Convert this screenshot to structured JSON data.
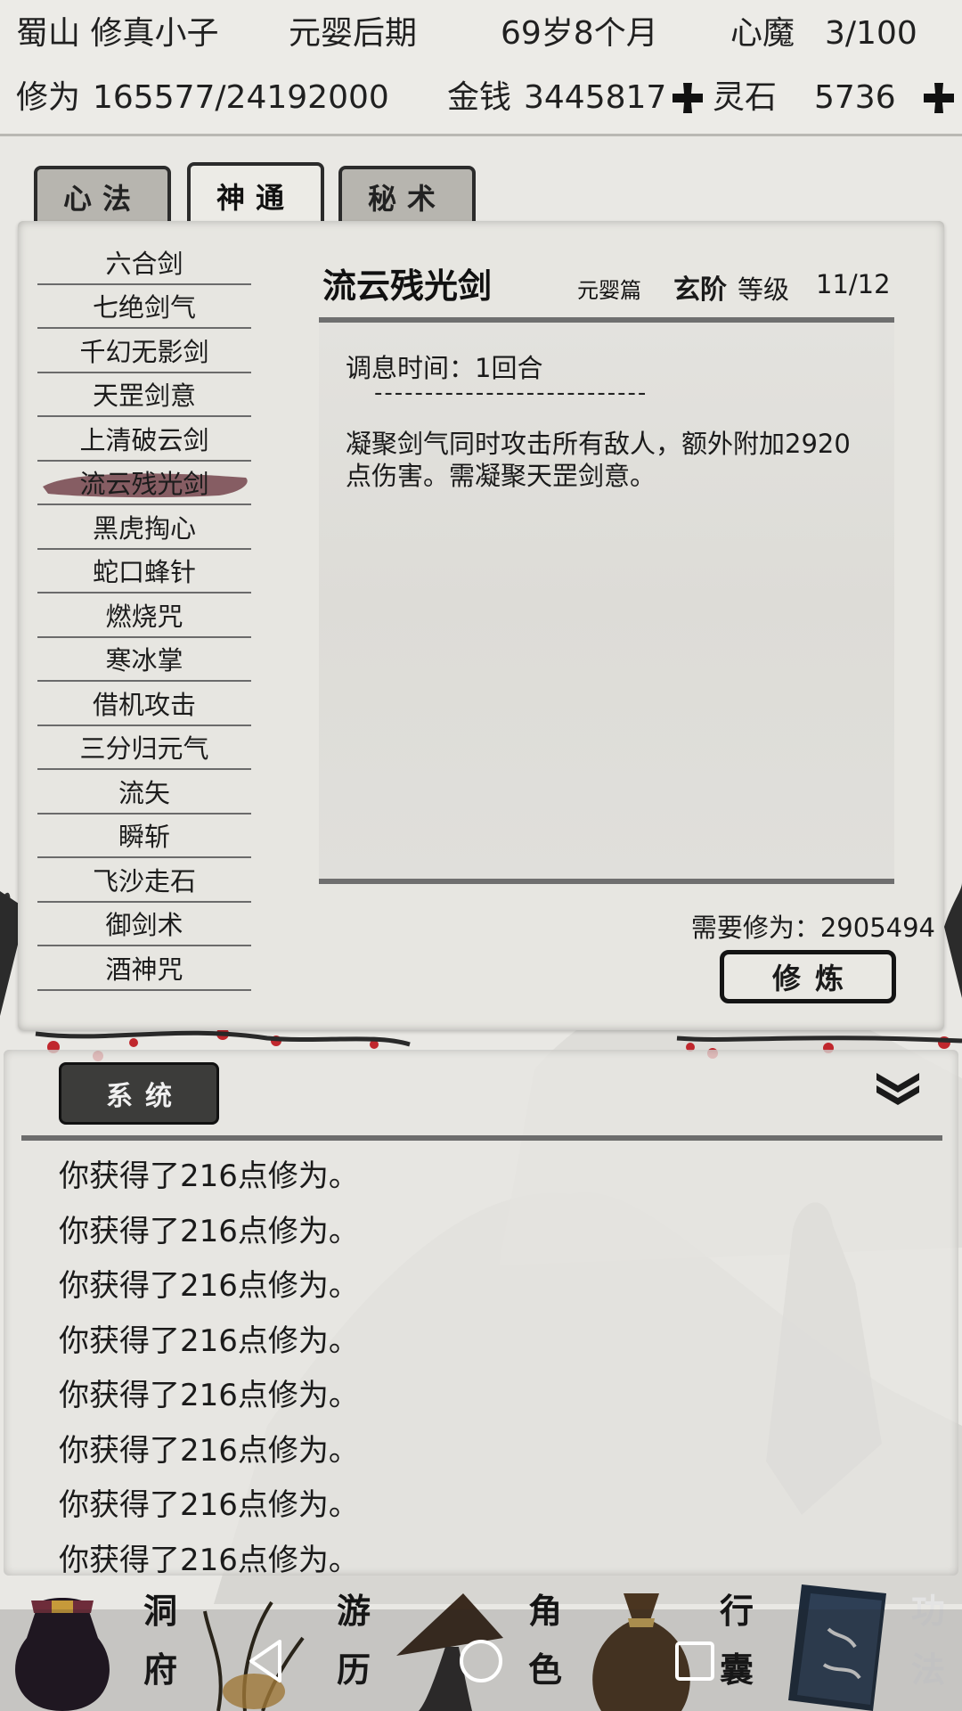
{
  "header": {
    "sect": "蜀山",
    "player_name": "修真小子",
    "realm": "元婴后期",
    "age": "69岁8个月",
    "heart_demon_label": "心魔",
    "heart_demon_value": "3/100",
    "cultivation_label": "修为",
    "cultivation_value": "165577/24192000",
    "money_label": "金钱",
    "money_value": "3445817",
    "spirit_stone_label": "灵石",
    "spirit_stone_value": "5736"
  },
  "tabs": [
    {
      "label": "心法",
      "active": false
    },
    {
      "label": "神通",
      "active": true
    },
    {
      "label": "秘术",
      "active": false
    }
  ],
  "skills": [
    "六合剑",
    "七绝剑气",
    "千幻无影剑",
    "天罡剑意",
    "上清破云剑",
    "流云残光剑",
    "黑虎掏心",
    "蛇口蜂针",
    "燃烧咒",
    "寒冰掌",
    "借机攻击",
    "三分归元气",
    "流矢",
    "瞬斩",
    "飞沙走石",
    "御剑术",
    "酒神咒"
  ],
  "selected_skill_index": 5,
  "detail": {
    "name": "流云残光剑",
    "chapter": "元婴篇",
    "tier": "玄阶",
    "level_label": "等级",
    "level": "11/12",
    "recovery_time": "调息时间：1回合",
    "separator": "---------------------------",
    "description": "凝聚剑气同时攻击所有敌人，额外附加2920点伤害。需凝聚天罡剑意。",
    "required_cultivation": "需要修为：2905494",
    "train_button": "修炼"
  },
  "log": {
    "tab_label": "系统",
    "entries": [
      "你获得了216点修为。",
      "你获得了216点修为。",
      "你获得了216点修为。",
      "你获得了216点修为。",
      "你获得了216点修为。",
      "你获得了216点修为。",
      "你获得了216点修为。",
      "你获得了216点修为。"
    ]
  },
  "bottom_nav": [
    {
      "label_1": "洞",
      "label_2": "府",
      "icon": "treasure-bag-icon"
    },
    {
      "label_1": "游",
      "label_2": "历",
      "icon": "reed-grass-icon"
    },
    {
      "label_1": "角",
      "label_2": "色",
      "icon": "bamboo-hat-icon"
    },
    {
      "label_1": "行",
      "label_2": "囊",
      "icon": "cloth-bag-icon"
    },
    {
      "label_1": "功",
      "label_2": "法",
      "icon": "scripture-book-icon"
    }
  ],
  "colors": {
    "paper": "#e7e6e1",
    "ink": "#141414",
    "selected_ink": "#6e3b44",
    "plum_red": "#c0272d"
  }
}
